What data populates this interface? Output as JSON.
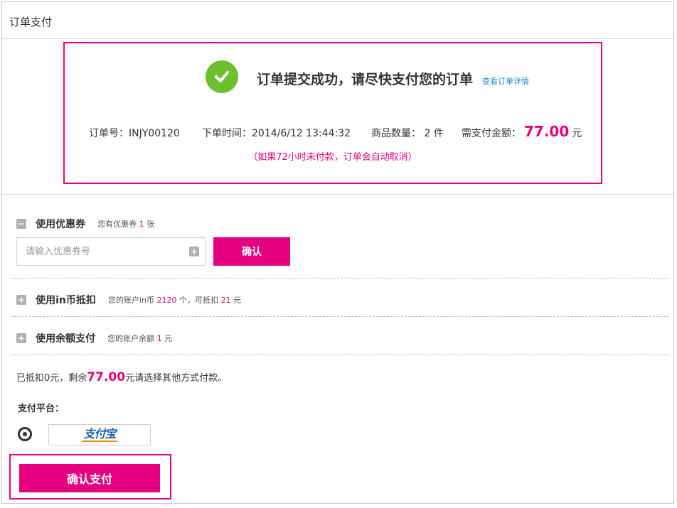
{
  "header": {
    "title": "订单支付"
  },
  "order": {
    "success_message": "订单提交成功，请尽快支付您的订单",
    "detail_link": "查看订单详情",
    "number_label": "订单号：",
    "number_value": "INJY00120",
    "time_label": "下单时间：",
    "time_value": "2014/6/12 13:44:32",
    "qty_label": "商品数量：",
    "qty_value": "2",
    "qty_unit": "件",
    "amount_label": "需支付金额：",
    "amount_value": "77.00",
    "amount_unit": "元",
    "warning": "（如果72小时未付款，订单会自动取消）"
  },
  "coupon": {
    "toggle": "−",
    "title": "使用优惠券",
    "note_prefix": "您有优惠券",
    "count": "1",
    "note_suffix": "张",
    "placeholder": "请输入优惠券号",
    "add_symbol": "+",
    "confirm_label": "确认"
  },
  "coin": {
    "toggle": "+",
    "title": "使用in币抵扣",
    "note_prefix": "您的账户in币",
    "coins": "2120",
    "note_mid": "个，可抵扣",
    "deduct": "21",
    "note_suffix": "元"
  },
  "balance": {
    "toggle": "+",
    "title": "使用余额支付",
    "note_prefix": "您的账户余额",
    "amount": "1",
    "note_suffix": "元"
  },
  "remaining": {
    "prefix": "已抵扣0元，剩余",
    "amount": "77.00",
    "suffix": "元请选择其他方式付款。"
  },
  "platform": {
    "label": "支付平台：",
    "selected": "支付宝",
    "icon": "alipay-logo"
  },
  "pay": {
    "label": "确认支付"
  },
  "colors": {
    "accent": "#e4007f",
    "success": "#6cbf2e",
    "link": "#1c8ccf"
  }
}
